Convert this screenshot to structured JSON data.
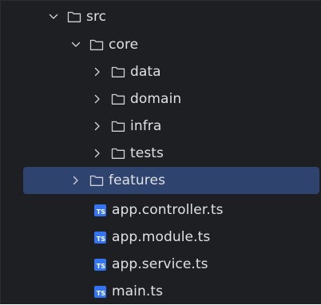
{
  "colors": {
    "panel_background": "#1e1f22",
    "selection_background": "#2e436e",
    "text": "#dfe1e5",
    "icon_stroke": "#ced0d6",
    "ts_badge": "#3574f0"
  },
  "tree": {
    "items": [
      {
        "label": "src",
        "type": "folder",
        "expanded": true,
        "depth": 0,
        "icon": "folder-icon"
      },
      {
        "label": "core",
        "type": "folder",
        "expanded": true,
        "depth": 1,
        "icon": "folder-icon"
      },
      {
        "label": "data",
        "type": "folder",
        "expanded": false,
        "depth": 2,
        "icon": "folder-icon"
      },
      {
        "label": "domain",
        "type": "folder",
        "expanded": false,
        "depth": 2,
        "icon": "folder-icon"
      },
      {
        "label": "infra",
        "type": "folder",
        "expanded": false,
        "depth": 2,
        "icon": "folder-icon"
      },
      {
        "label": "tests",
        "type": "folder",
        "expanded": false,
        "depth": 2,
        "icon": "folder-icon"
      },
      {
        "label": "features",
        "type": "folder",
        "expanded": false,
        "depth": 1,
        "selected": true,
        "icon": "folder-icon"
      },
      {
        "label": "app.controller.ts",
        "type": "file",
        "depth": 1,
        "icon": "typescript-file-icon",
        "badge": "TS"
      },
      {
        "label": "app.module.ts",
        "type": "file",
        "depth": 1,
        "icon": "typescript-file-icon",
        "badge": "TS"
      },
      {
        "label": "app.service.ts",
        "type": "file",
        "depth": 1,
        "icon": "typescript-file-icon",
        "badge": "TS"
      },
      {
        "label": "main.ts",
        "type": "file",
        "depth": 1,
        "icon": "typescript-file-icon",
        "badge": "TS"
      }
    ]
  }
}
